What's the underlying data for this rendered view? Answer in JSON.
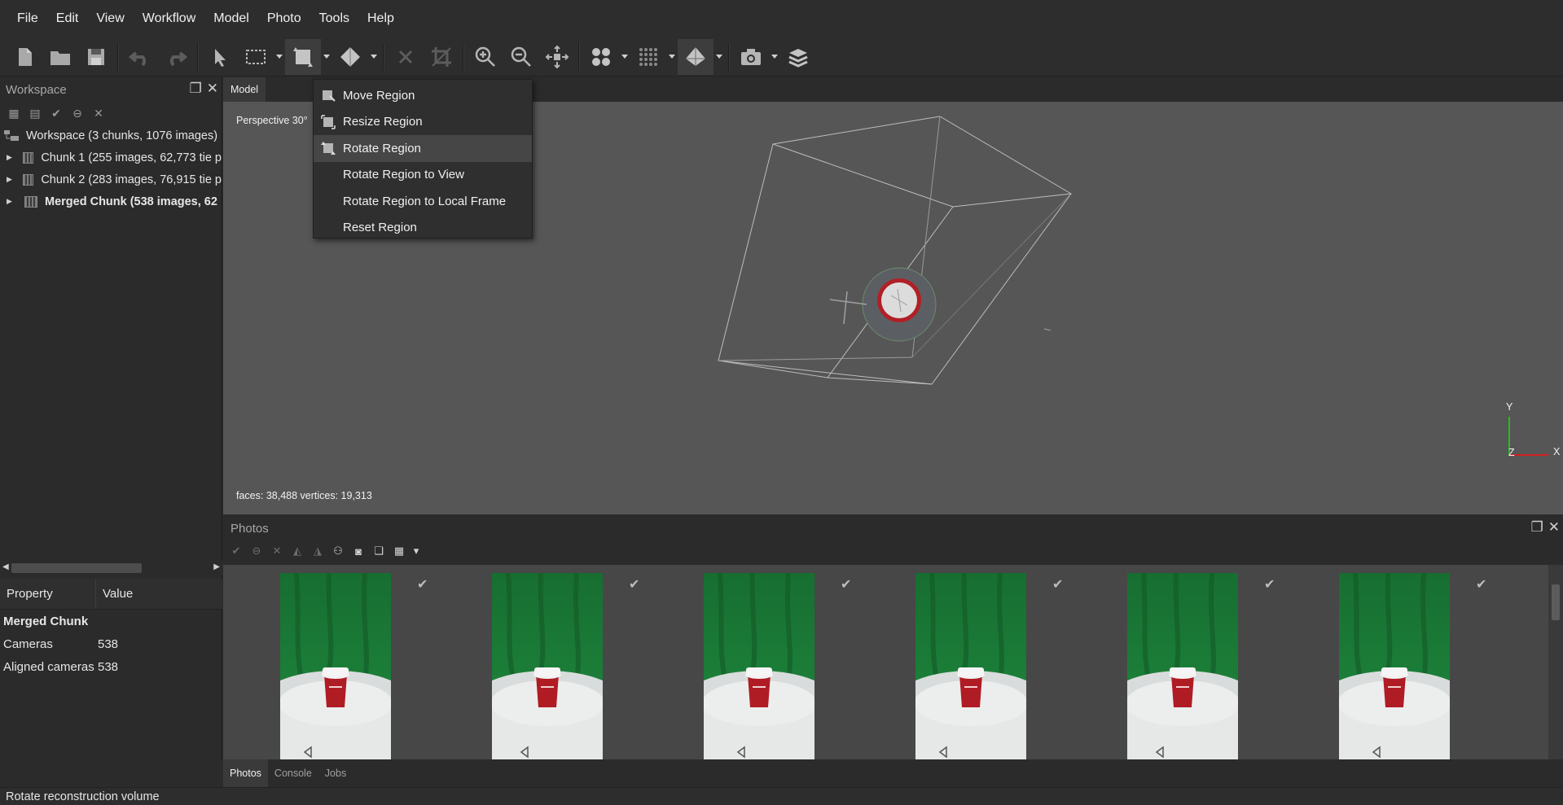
{
  "menubar": {
    "items": [
      {
        "label": "File"
      },
      {
        "label": "Edit"
      },
      {
        "label": "View"
      },
      {
        "label": "Workflow"
      },
      {
        "label": "Model"
      },
      {
        "label": "Photo"
      },
      {
        "label": "Tools"
      },
      {
        "label": "Help"
      }
    ]
  },
  "workspace": {
    "title": "Workspace",
    "root": "Workspace (3 chunks, 1076 images)",
    "chunks": [
      {
        "label": "Chunk 1 (255 images, 62,773 tie p"
      },
      {
        "label": "Chunk 2 (283 images, 76,915 tie p"
      },
      {
        "label": "Merged Chunk (538 images, 62"
      }
    ]
  },
  "properties": {
    "col_property": "Property",
    "col_value": "Value",
    "group": "Merged Chunk",
    "rows": [
      {
        "key": "Cameras",
        "value": "538"
      },
      {
        "key": "Aligned cameras",
        "value": "538"
      }
    ]
  },
  "model": {
    "tab": "Model",
    "projection": "Perspective 30°",
    "stats": "faces: 38,488 vertices: 19,313",
    "axes": {
      "y": "Y",
      "x": "X",
      "z": "Z"
    }
  },
  "region_menu": {
    "items": [
      {
        "label": "Move Region",
        "icon": "move-region-icon"
      },
      {
        "label": "Resize Region",
        "icon": "resize-region-icon"
      },
      {
        "label": "Rotate Region",
        "icon": "rotate-region-icon",
        "highlighted": true
      },
      {
        "label": "Rotate Region to View"
      },
      {
        "label": "Rotate Region to Local Frame"
      },
      {
        "label": "Reset Region"
      }
    ]
  },
  "photos": {
    "title": "Photos",
    "thumbnail_count": 6
  },
  "bottom_tabs": [
    {
      "label": "Photos",
      "selected": true
    },
    {
      "label": "Console"
    },
    {
      "label": "Jobs"
    }
  ],
  "status": "Rotate reconstruction volume",
  "colors": {
    "background": "#2b2b2b",
    "viewport": "#565656",
    "green_screen": "#1f8a3e",
    "cup_red": "#b01c24",
    "axis_x": "#d02020",
    "axis_y": "#20c020"
  }
}
